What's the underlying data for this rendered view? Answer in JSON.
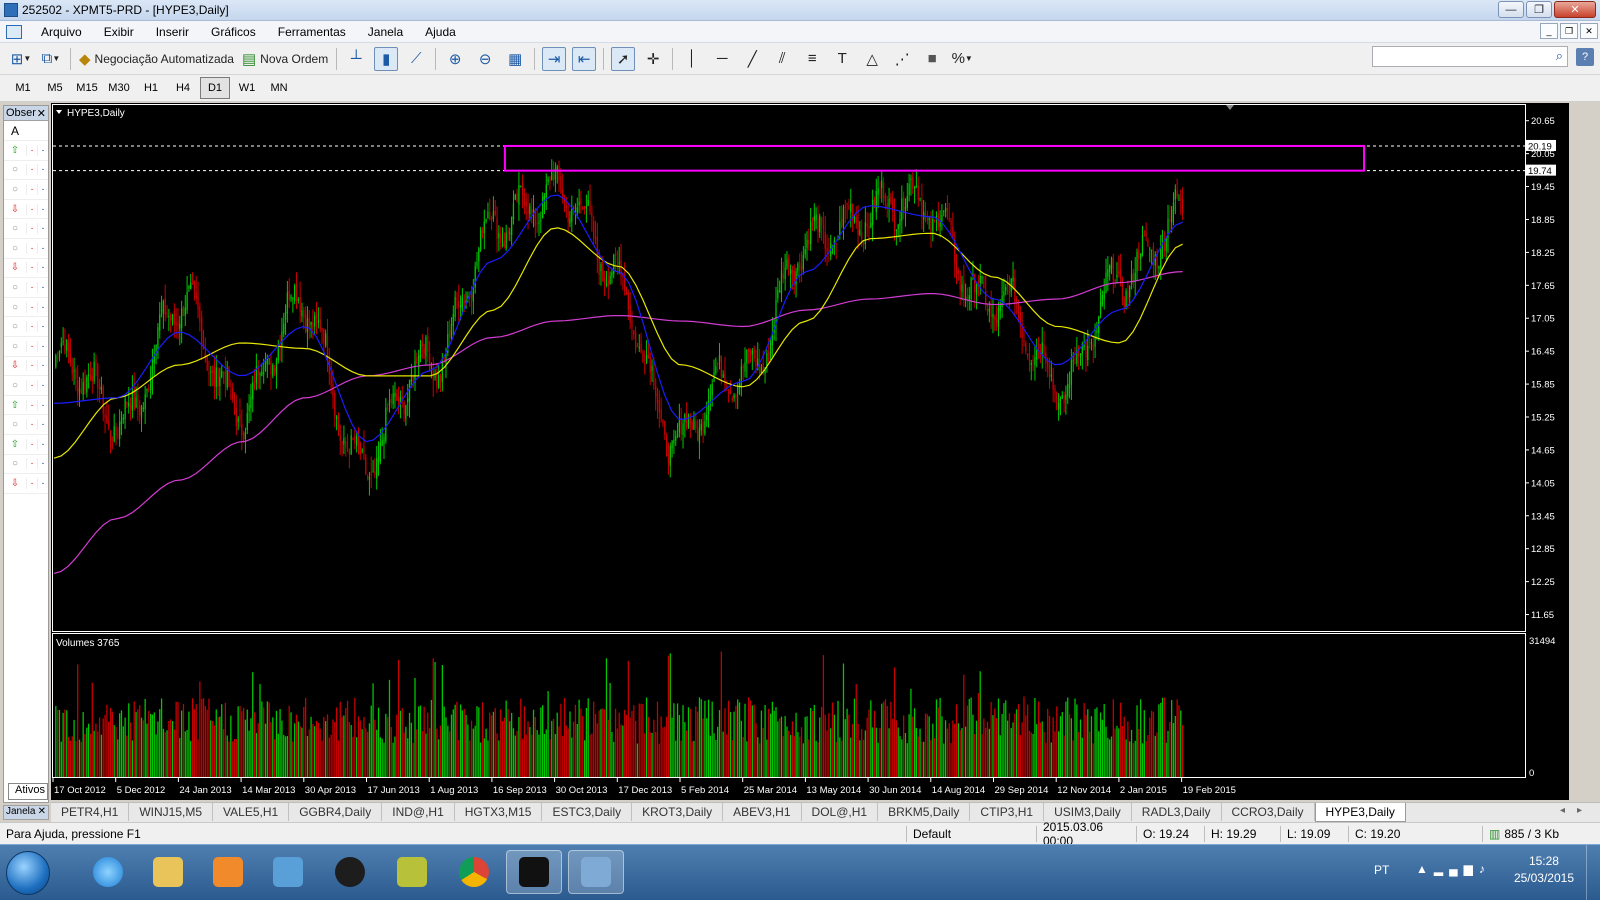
{
  "window": {
    "title": "252502 - XPMT5-PRD - [HYPE3,Daily]"
  },
  "menu": [
    "Arquivo",
    "Exibir",
    "Inserir",
    "Gráficos",
    "Ferramentas",
    "Janela",
    "Ajuda"
  ],
  "toolbar": {
    "auto_trading_label": "Negociação Automatizada",
    "new_order_label": "Nova Ordem"
  },
  "timeframes": [
    "M1",
    "M5",
    "M15",
    "M30",
    "H1",
    "H4",
    "D1",
    "W1",
    "MN"
  ],
  "active_timeframe": "D1",
  "left_panel": {
    "title": "Obser",
    "letter": "A",
    "tab_label": "Ativos",
    "janela_label": "Janela"
  },
  "chart_data": {
    "type": "line",
    "title": "HYPE3,Daily",
    "price_axis_ticks": [
      20.65,
      20.05,
      19.45,
      18.85,
      18.25,
      17.65,
      17.05,
      16.45,
      15.85,
      15.25,
      14.65,
      14.05,
      13.45,
      12.85,
      12.25,
      11.65
    ],
    "price_axis_range": [
      11.35,
      20.9
    ],
    "marked_levels": [
      {
        "label": "20.19",
        "value": 20.19
      },
      {
        "label": "19.74",
        "value": 19.74
      }
    ],
    "date_ticks": [
      "17 Oct 2012",
      "5 Dec 2012",
      "24 Jan 2013",
      "14 Mar 2013",
      "30 Apr 2013",
      "17 Jun 2013",
      "1 Aug 2013",
      "16 Sep 2013",
      "30 Oct 2013",
      "17 Dec 2013",
      "5 Feb 2014",
      "25 Mar 2014",
      "13 May 2014",
      "30 Jun 2014",
      "14 Aug 2014",
      "29 Sep 2014",
      "12 Nov 2014",
      "2 Jan 2015",
      "19 Feb 2015"
    ],
    "price_series": [
      [
        "17 Oct 2012",
        16.2
      ],
      [
        "5 Dec 2012",
        15.3
      ],
      [
        "24 Jan 2013",
        17.1
      ],
      [
        "14 Mar 2013",
        15.6
      ],
      [
        "30 Apr 2013",
        17.2
      ],
      [
        "17 Jun 2013",
        14.3
      ],
      [
        "1 Aug 2013",
        16.4
      ],
      [
        "16 Sep 2013",
        18.5
      ],
      [
        "30 Oct 2013",
        19.6
      ],
      [
        "17 Dec 2013",
        17.6
      ],
      [
        "5 Feb 2014",
        14.8
      ],
      [
        "25 Mar 2014",
        16.2
      ],
      [
        "13 May 2014",
        18.2
      ],
      [
        "30 Jun 2014",
        19.2
      ],
      [
        "14 Aug 2014",
        18.9
      ],
      [
        "29 Sep 2014",
        17.3
      ],
      [
        "12 Nov 2014",
        16.0
      ],
      [
        "2 Jan 2015",
        17.5
      ],
      [
        "19 Feb 2015",
        19.2
      ]
    ],
    "ma_fast": [
      15.5,
      15.6,
      16.8,
      16.0,
      16.9,
      14.8,
      16.1,
      18.1,
      19.3,
      17.9,
      15.2,
      15.9,
      17.9,
      19.1,
      18.9,
      17.4,
      16.2,
      17.2,
      18.8
    ],
    "ma_slow": [
      14.5,
      15.6,
      16.2,
      16.6,
      16.5,
      16.0,
      16.0,
      17.2,
      18.7,
      18.0,
      16.2,
      15.8,
      17.0,
      18.5,
      18.6,
      17.8,
      16.9,
      16.6,
      18.4
    ],
    "ma_long": [
      12.4,
      13.4,
      14.1,
      14.8,
      15.6,
      16.0,
      16.2,
      16.7,
      17.0,
      17.1,
      17.0,
      16.9,
      17.2,
      17.4,
      17.5,
      17.3,
      17.4,
      17.7,
      17.9
    ],
    "rectangle": {
      "from": "16 Sep 2013",
      "to": "after 19 Feb 2015",
      "low": 19.74,
      "high": 20.19
    },
    "volume": {
      "label": "Volumes 3765",
      "axis_ticks": [
        "31494",
        "0"
      ],
      "axis_range": [
        0,
        31494
      ]
    },
    "colors": {
      "bull": "#00c800",
      "bear": "#c80000",
      "ma_fast": "#1c1cff",
      "ma_slow": "#e6e600",
      "ma_long": "#d23cd2",
      "rectangle": "#ff00ff"
    }
  },
  "tabs": [
    "PETR4,H1",
    "WINJ15,M5",
    "VALE5,H1",
    "GGBR4,Daily",
    "IND@,H1",
    "HGTX3,M15",
    "ESTC3,Daily",
    "KROT3,Daily",
    "ABEV3,H1",
    "DOL@,H1",
    "BRKM5,Daily",
    "CTIP3,H1",
    "USIM3,Daily",
    "RADL3,Daily",
    "CCRO3,Daily",
    "HYPE3,Daily"
  ],
  "active_tab": "HYPE3,Daily",
  "status": {
    "help": "Para Ajuda, pressione F1",
    "profile": "Default",
    "datetime": "2015.03.06 00:00",
    "open": "O: 19.24",
    "high": "H: 19.29",
    "low": "L: 19.09",
    "close": "C: 19.20",
    "traffic": "885 / 3 Kb"
  },
  "taskbar": {
    "lang": "PT",
    "time": "15:28",
    "date": "25/03/2015"
  }
}
